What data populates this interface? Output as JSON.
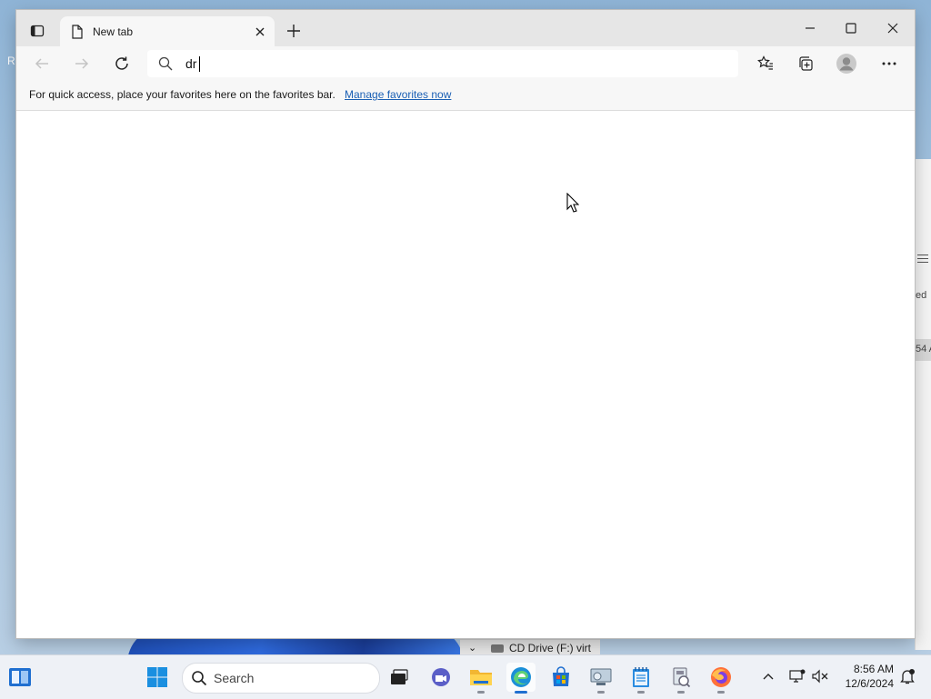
{
  "browser": {
    "tab": {
      "title": "New tab"
    },
    "address": {
      "value": "dr"
    },
    "favorites_bar": {
      "message": "For quick access, place your favorites here on the favorites bar.",
      "link": "Manage favorites now"
    }
  },
  "background": {
    "explorer_item": "CD Drive (F:) virt",
    "right_window_text_1": "ed",
    "right_window_text_2": "54 A"
  },
  "taskbar": {
    "search_label": "Search",
    "clock": {
      "time": "8:56 AM",
      "date": "12/6/2024"
    },
    "pinned": [
      "task-view",
      "teams-chat",
      "file-explorer",
      "edge",
      "store",
      "settings-app",
      "notepad",
      "device-app",
      "firefox"
    ]
  },
  "colors": {
    "accent": "#1f6fd0",
    "link": "#1a5fb4",
    "titlebar": "#e6e6e6"
  }
}
